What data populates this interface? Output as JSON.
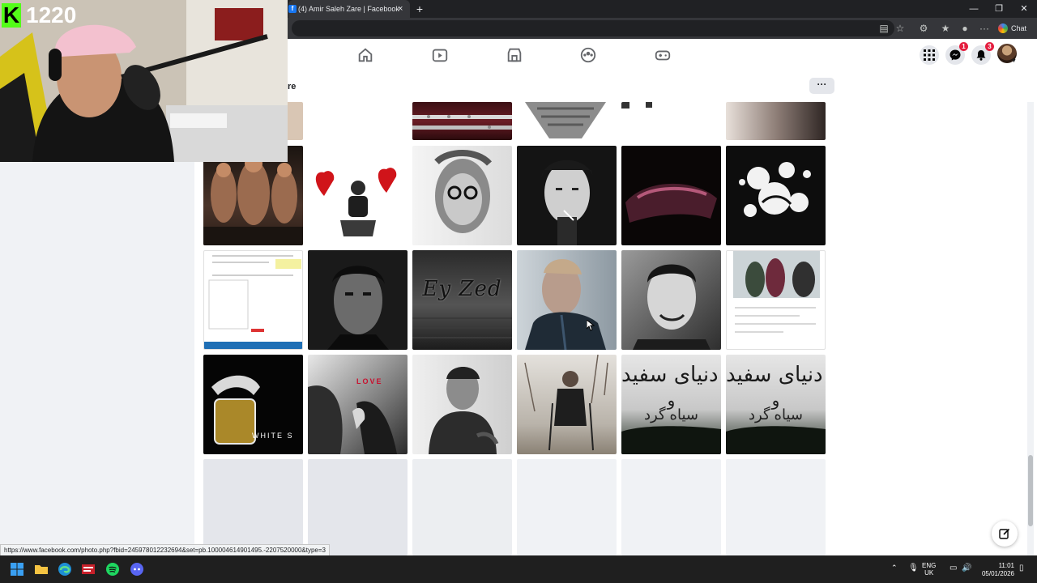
{
  "browser": {
    "tab_title": "(4) Amir Saleh Zare | Facebook",
    "tab_favicon": "f",
    "tab_close": "×",
    "new_tab": "+",
    "window_minimize": "—",
    "window_restore": "❐",
    "window_close": "✕",
    "more": "···",
    "chat_label": "Chat",
    "status_url": "https://www.facebook.com/photo.php?fbid=245978012232694&set=pb.100004614901495.-2207520000&type=3"
  },
  "fb_header": {
    "nav": [
      "home-icon",
      "video-icon",
      "marketplace-icon",
      "groups-icon",
      "gaming-icon"
    ],
    "messenger_badge": "1",
    "notifications_badge": "3"
  },
  "page": {
    "subtitle_fragment": "re",
    "more_button": "···"
  },
  "photos": {
    "row0": [
      "beard portrait",
      "flute",
      "hands",
      "fragment",
      "bw portrait"
    ],
    "tiles": [
      {
        "caption": ""
      },
      {
        "caption": ""
      },
      {
        "caption": ""
      },
      {
        "caption": ""
      },
      {
        "caption": ""
      },
      {
        "caption": ""
      },
      {
        "caption": ""
      },
      {
        "caption": ""
      },
      {
        "caption": "Ey Zed"
      },
      {
        "caption": ""
      },
      {
        "caption": ""
      },
      {
        "caption": ""
      },
      {
        "caption": "WHITE S"
      },
      {
        "caption": "LOVE"
      },
      {
        "caption": ""
      },
      {
        "caption": ""
      },
      {
        "caption": "ن دنیای سفید"
      },
      {
        "caption": "ن دنیای سفید"
      }
    ],
    "tile_overlay_1": "و",
    "tile_overlay_2": "سیاه گرد"
  },
  "webcam": {
    "counter": "1220",
    "logo_letter": "K"
  },
  "taskbar": {
    "lang_top": "ENG",
    "lang_bottom": "UK",
    "time": "11:01",
    "date": "05/01/2026"
  }
}
